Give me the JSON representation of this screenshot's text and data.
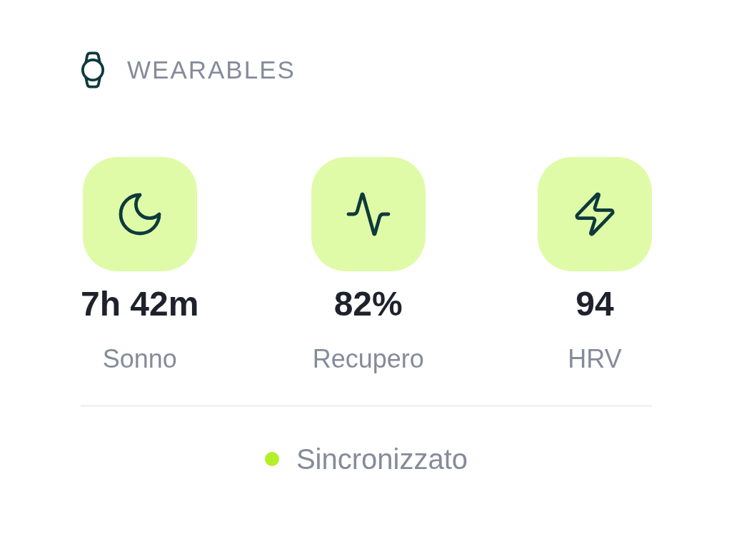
{
  "header": {
    "title": "WEARABLES"
  },
  "metrics": [
    {
      "kind": "sleep",
      "value": "7h 42m",
      "label": "Sonno"
    },
    {
      "kind": "recovery",
      "value": "82%",
      "label": "Recupero"
    },
    {
      "kind": "hrv",
      "value": "94",
      "label": "HRV"
    }
  ],
  "status": {
    "label": "Sincronizzato",
    "color": "#b4f02a"
  }
}
